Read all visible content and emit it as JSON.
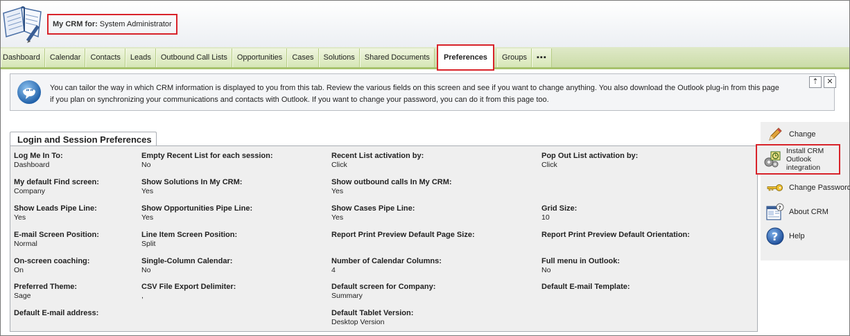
{
  "header": {
    "title_label": "My CRM for:",
    "user_name": "System Administrator"
  },
  "tabs": [
    {
      "label": "Dashboard"
    },
    {
      "label": "Calendar"
    },
    {
      "label": "Contacts"
    },
    {
      "label": "Leads"
    },
    {
      "label": "Outbound Call Lists"
    },
    {
      "label": "Opportunities"
    },
    {
      "label": "Cases"
    },
    {
      "label": "Solutions"
    },
    {
      "label": "Shared Documents"
    },
    {
      "label": "Preferences",
      "active": true
    },
    {
      "label": "Groups"
    },
    {
      "label": "▪▪▪"
    }
  ],
  "info": {
    "line1": "You can tailor the way in which CRM information is displayed to you from this tab. Review the various fields on this screen and see if you want to change anything. You also download the Outlook plug-in from this page",
    "line2": "if you plan on synchronizing your communications and contacts with Outlook. If you want to change your password, you can do it from this page too.",
    "icon": "speech-bubble-icon"
  },
  "panel": {
    "title": "Login and Session Preferences",
    "fields": [
      {
        "label": "Log Me In To:",
        "value": "Dashboard"
      },
      {
        "label": "Empty Recent List for each session:",
        "value": "No"
      },
      {
        "label": "Recent List activation by:",
        "value": "Click"
      },
      {
        "label": "Pop Out List activation by:",
        "value": "Click"
      },
      {
        "label": "My default Find screen:",
        "value": "Company"
      },
      {
        "label": "Show Solutions In My CRM:",
        "value": "Yes"
      },
      {
        "label": "Show outbound calls In My CRM:",
        "value": "Yes"
      },
      {
        "label": "Show Leads Pipe Line:",
        "value": "Yes"
      },
      {
        "label": "Show Opportunities Pipe Line:",
        "value": "Yes"
      },
      {
        "label": "Show Cases Pipe Line:",
        "value": "Yes"
      },
      {
        "label": "Grid Size:",
        "value": "10"
      },
      {
        "label": "E-mail Screen Position:",
        "value": "Normal"
      },
      {
        "label": "Line Item Screen Position:",
        "value": "Split"
      },
      {
        "label": "Report Print Preview Default Page Size:",
        "value": ""
      },
      {
        "label": "Report Print Preview Default Orientation:",
        "value": ""
      },
      {
        "label": "On-screen coaching:",
        "value": "On"
      },
      {
        "label": "Single-Column Calendar:",
        "value": "No"
      },
      {
        "label": "Number of Calendar Columns:",
        "value": "4"
      },
      {
        "label": "Full menu in Outlook:",
        "value": "No"
      },
      {
        "label": "Preferred Theme:",
        "value": "Sage"
      },
      {
        "label": "CSV File Export Delimiter:",
        "value": ","
      },
      {
        "label": "Default screen for Company:",
        "value": "Summary"
      },
      {
        "label": "Default E-mail Template:",
        "value": ""
      },
      {
        "label": "Default E-mail address:",
        "value": ""
      },
      {
        "label": "Default Tablet Version:",
        "value": "Desktop Version"
      }
    ]
  },
  "actions": {
    "change": "Change",
    "install_line1": "Install CRM",
    "install_line2": "Outlook",
    "install_line3": "integration",
    "change_password": "Change Password",
    "about": "About CRM",
    "help": "Help"
  },
  "colors": {
    "highlight": "#d8232a",
    "tab_bar": "#cbdca8",
    "panel_bg": "#efefef"
  }
}
